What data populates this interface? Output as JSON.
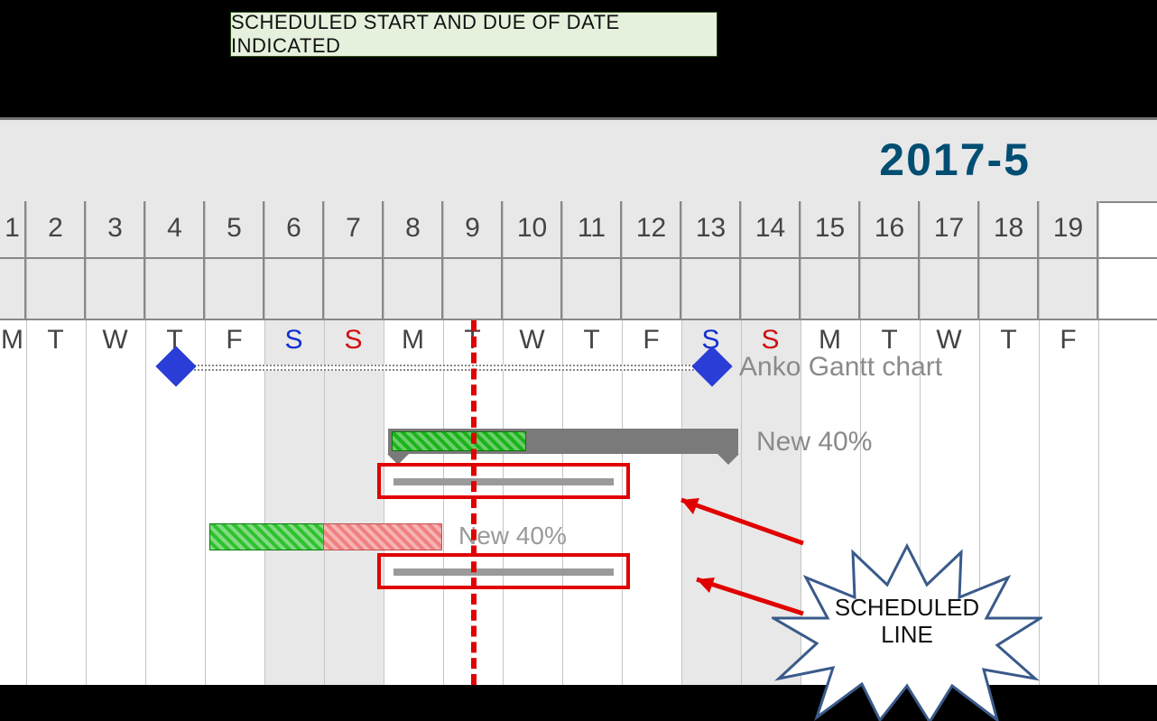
{
  "title_callout": "SCHEDULED START AND DUE OF DATE INDICATED",
  "annotation_starburst": "SCHEDULED\nLINE",
  "chart_data": {
    "type": "gantt",
    "title": "2017-5",
    "month_label": "2017-5",
    "today": 9,
    "days": [
      {
        "n": "1",
        "dow": "M",
        "weekend": false
      },
      {
        "n": "2",
        "dow": "T",
        "weekend": false
      },
      {
        "n": "3",
        "dow": "W",
        "weekend": false
      },
      {
        "n": "4",
        "dow": "T",
        "weekend": false
      },
      {
        "n": "5",
        "dow": "F",
        "weekend": false
      },
      {
        "n": "6",
        "dow": "S",
        "weekend": true,
        "sat": true
      },
      {
        "n": "7",
        "dow": "S",
        "weekend": true,
        "sun": true
      },
      {
        "n": "8",
        "dow": "M",
        "weekend": false
      },
      {
        "n": "9",
        "dow": "T",
        "weekend": false
      },
      {
        "n": "10",
        "dow": "W",
        "weekend": false
      },
      {
        "n": "11",
        "dow": "T",
        "weekend": false
      },
      {
        "n": "12",
        "dow": "F",
        "weekend": false
      },
      {
        "n": "13",
        "dow": "S",
        "weekend": true,
        "sat": true
      },
      {
        "n": "14",
        "dow": "S",
        "weekend": true,
        "sun": true
      },
      {
        "n": "15",
        "dow": "M",
        "weekend": false
      },
      {
        "n": "16",
        "dow": "T",
        "weekend": false
      },
      {
        "n": "17",
        "dow": "W",
        "weekend": false
      },
      {
        "n": "18",
        "dow": "T",
        "weekend": false
      },
      {
        "n": "19",
        "dow": "F",
        "weekend": false
      }
    ],
    "rows": [
      {
        "type": "milestone",
        "name": "Anko Gantt chart",
        "start": 4,
        "end": 13
      },
      {
        "type": "task",
        "name": "New 40%",
        "start": 8,
        "end": 13,
        "progress": 40,
        "scheduled_start": 8,
        "scheduled_end": 11
      },
      {
        "type": "bar",
        "name": "New 40%",
        "start": 5,
        "end": 8,
        "green_end": 6,
        "scheduled_start": 8,
        "scheduled_end": 11
      }
    ]
  }
}
